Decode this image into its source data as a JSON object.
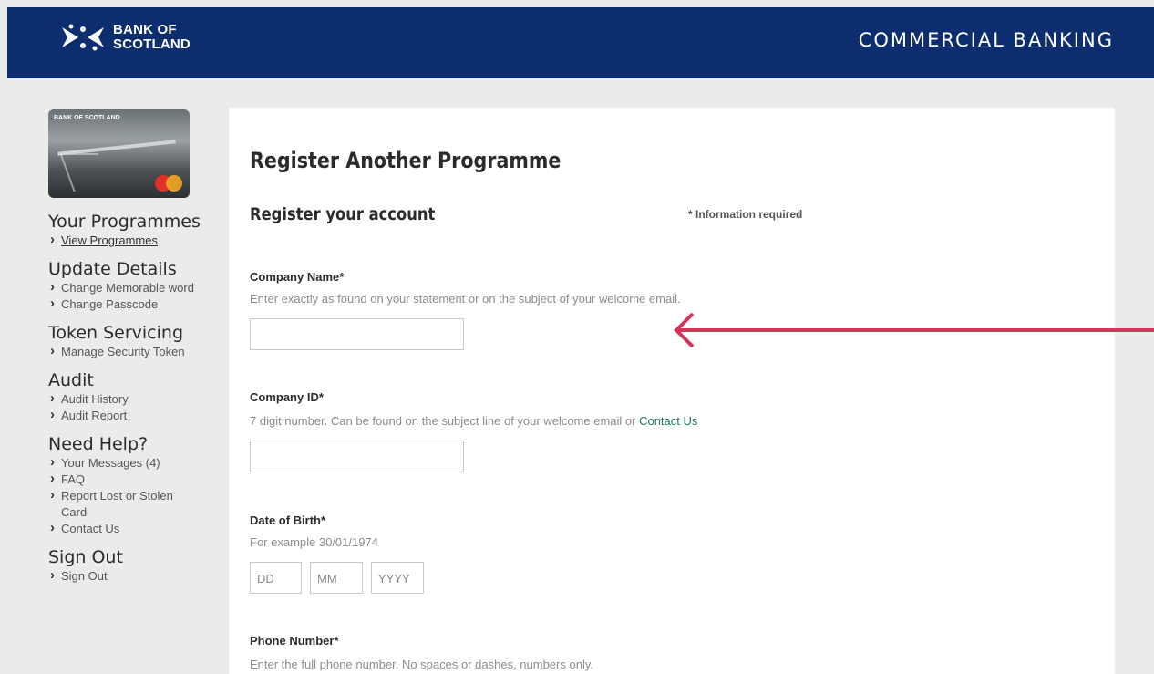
{
  "header": {
    "bank_line1": "BANK OF",
    "bank_line2": "SCOTLAND",
    "section": "COMMERCIAL BANKING",
    "brand_color": "#0d2e6e"
  },
  "card": {
    "label": "BANK OF SCOTLAND"
  },
  "sidebar": {
    "groups": [
      {
        "title": "Your Programmes",
        "links": [
          "View Programmes"
        ]
      },
      {
        "title": "Update Details",
        "links": [
          "Change Memorable word",
          "Change Passcode"
        ]
      },
      {
        "title": "Token Servicing",
        "links": [
          "Manage Security Token"
        ]
      },
      {
        "title": "Audit",
        "links": [
          "Audit History",
          "Audit Report"
        ]
      },
      {
        "title": "Need Help?",
        "links": [
          "Your Messages (4)",
          "FAQ",
          "Report Lost or Stolen Card",
          "Contact Us"
        ]
      },
      {
        "title": "Sign Out",
        "links": [
          "Sign Out"
        ]
      }
    ]
  },
  "main": {
    "title": "Register Another Programme",
    "subtitle": "Register your account",
    "required_note": "* Information required",
    "fields": {
      "company_name": {
        "label": "Company Name*",
        "hint": "Enter exactly as found on your statement or on the subject of your welcome email.",
        "value": ""
      },
      "company_id": {
        "label": "Company ID*",
        "hint": "7 digit number. Can be found on the subject line of your welcome email or ",
        "hint_link": "Contact Us",
        "value": ""
      },
      "dob": {
        "label": "Date of Birth*",
        "hint": "For example 30/01/1974",
        "dd": "DD",
        "mm": "MM",
        "yyyy": "YYYY"
      },
      "phone": {
        "label": "Phone Number*",
        "hint": "Enter the full phone number. No spaces or dashes, numbers only."
      }
    }
  },
  "annotation": {
    "arrow_color": "#d6335a"
  }
}
